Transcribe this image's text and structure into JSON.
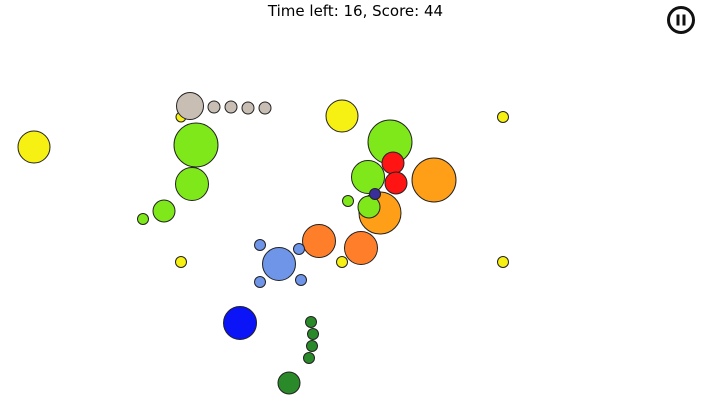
{
  "hud": {
    "status_text": "Time left: 16, Score: 44"
  },
  "controls": {
    "pause_icon": "pause-icon"
  },
  "palette": {
    "yellow": "#f7f013",
    "lime": "#7fe81b",
    "orange": "#ff7e2a",
    "amber": "#ff9f18",
    "red": "#ff1414",
    "blue": "#0a14f6",
    "sky": "#6e95e8",
    "green": "#2a8a2a",
    "taupe": "#c8beb4",
    "navy": "#3a2f9a"
  },
  "game": {
    "ball_count": 36
  }
}
